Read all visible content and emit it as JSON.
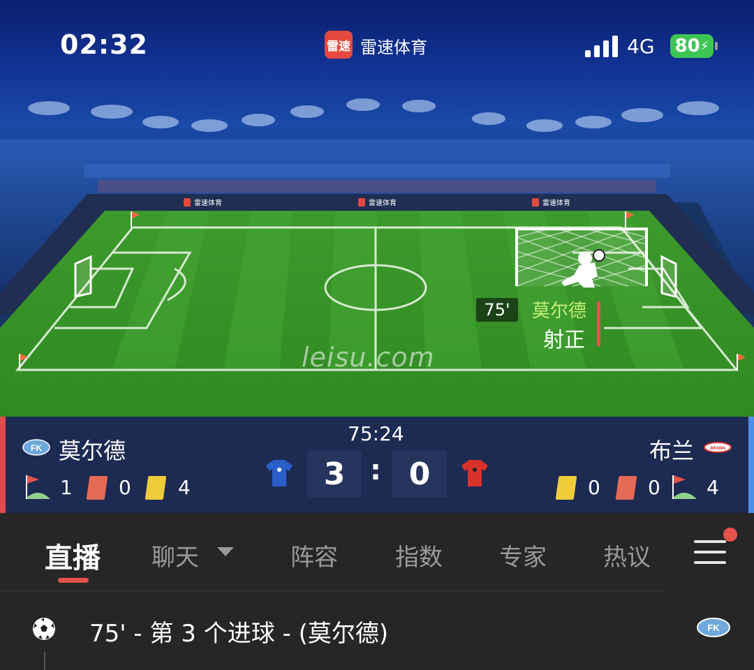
{
  "status_bar": {
    "time": "02:32",
    "network": "4G",
    "battery": "80"
  },
  "app": {
    "badge": "雷速",
    "title": "雷速体育"
  },
  "pitch": {
    "event_minute": "75'",
    "event_team": "莫尔德",
    "event_type": "射正",
    "watermark": "leisu.com",
    "ad_boards": [
      "雷速体育",
      "雷速体育",
      "雷速体育"
    ]
  },
  "match": {
    "time": "75:24",
    "home": {
      "name": "莫尔德",
      "logo_text": "FK",
      "corners": "1",
      "red_cards": "0",
      "yellow_cards": "4",
      "score": "3",
      "jersey_color": "#2a5fc8"
    },
    "away": {
      "name": "布兰",
      "logo_text": "BRANN",
      "yellow_cards": "0",
      "red_cards": "0",
      "corners": "4",
      "score": "0",
      "jersey_color": "#d9322b"
    },
    "separator": ":"
  },
  "tabs": [
    {
      "label": "直播",
      "active": true
    },
    {
      "label": "聊天",
      "active": false
    },
    {
      "label": "阵容",
      "active": false
    },
    {
      "label": "指数",
      "active": false
    },
    {
      "label": "专家",
      "active": false
    },
    {
      "label": "热议",
      "active": false
    }
  ],
  "feed": [
    {
      "text": "75' - 第 3 个进球 - (莫尔德)",
      "icon": "soccer-ball-icon"
    }
  ],
  "colors": {
    "accent": "#e5524a",
    "home_edge": "#e24b4b",
    "away_edge": "#4c8fe8",
    "scorebar_bg": "#1d2a52"
  }
}
